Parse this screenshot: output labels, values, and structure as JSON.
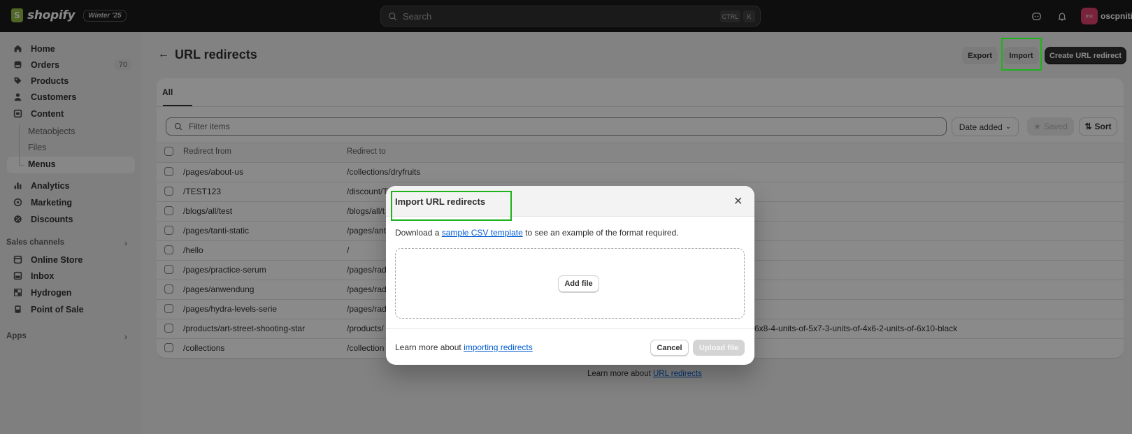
{
  "topbar": {
    "brand": "shopify",
    "edition": "Winter '25",
    "search_placeholder": "Search",
    "shortcut_keys": [
      "CTRL",
      "K"
    ],
    "avatar_initials": "osc",
    "store_name": "oscpnitin"
  },
  "sidebar": {
    "items": [
      {
        "label": "Home",
        "icon": "home-icon"
      },
      {
        "label": "Orders",
        "icon": "orders-icon",
        "badge": "70"
      },
      {
        "label": "Products",
        "icon": "tag-icon"
      },
      {
        "label": "Customers",
        "icon": "person-icon"
      },
      {
        "label": "Content",
        "icon": "content-icon"
      }
    ],
    "content_sub": [
      "Metaobjects",
      "Files",
      "Menus"
    ],
    "items2": [
      {
        "label": "Analytics",
        "icon": "bar-chart-icon"
      },
      {
        "label": "Marketing",
        "icon": "target-icon"
      },
      {
        "label": "Discounts",
        "icon": "discount-icon"
      }
    ],
    "sales_channels_heading": "Sales channels",
    "channels": [
      {
        "label": "Online Store",
        "icon": "store-icon"
      },
      {
        "label": "Inbox",
        "icon": "inbox-icon"
      },
      {
        "label": "Hydrogen",
        "icon": "hydrogen-icon"
      },
      {
        "label": "Point of Sale",
        "icon": "pos-icon"
      }
    ],
    "apps_heading": "Apps"
  },
  "page": {
    "title": "URL redirects",
    "export_label": "Export",
    "import_label": "Import",
    "create_label": "Create URL redirect",
    "tab_all": "All",
    "filter_placeholder": "Filter items",
    "date_added_label": "Date added",
    "saved_label": "Saved",
    "sort_label": "Sort",
    "col_from": "Redirect from",
    "col_to": "Redirect to",
    "rows": [
      {
        "from": "/pages/about-us",
        "to": "/collections/dryfruits"
      },
      {
        "from": "/TEST123",
        "to": "/discount/T"
      },
      {
        "from": "/blogs/all/test",
        "to": "/blogs/all/t"
      },
      {
        "from": "/pages/tanti-static",
        "to": "/pages/ant"
      },
      {
        "from": "/hello",
        "to": "/"
      },
      {
        "from": "/pages/practice-serum",
        "to": "/pages/rad"
      },
      {
        "from": "/pages/anwendung",
        "to": "/pages/rad"
      },
      {
        "from": "/pages/hydra-levels-serie",
        "to": "/pages/rad"
      },
      {
        "from": "/products/art-street-shooting-star",
        "to": "/products/"
      },
      {
        "from": "/collections",
        "to": "/collection"
      }
    ],
    "row9_to_tail": "6x8-4-units-of-5x7-3-units-of-4x6-2-units-of-6x10-black",
    "footer_prefix": "Learn more about ",
    "footer_link": "URL redirects"
  },
  "modal": {
    "title": "Import URL redirects",
    "desc_prefix": "Download a ",
    "desc_link": "sample CSV template",
    "desc_suffix": " to see an example of the format required.",
    "add_file_label": "Add file",
    "learn_prefix": "Learn more about ",
    "learn_link": "importing redirects",
    "cancel_label": "Cancel",
    "upload_label": "Upload file"
  },
  "colors": {
    "highlight": "#1db31d",
    "primary_button": "#303030",
    "link": "#005bd3",
    "avatar": "#e0416f"
  }
}
